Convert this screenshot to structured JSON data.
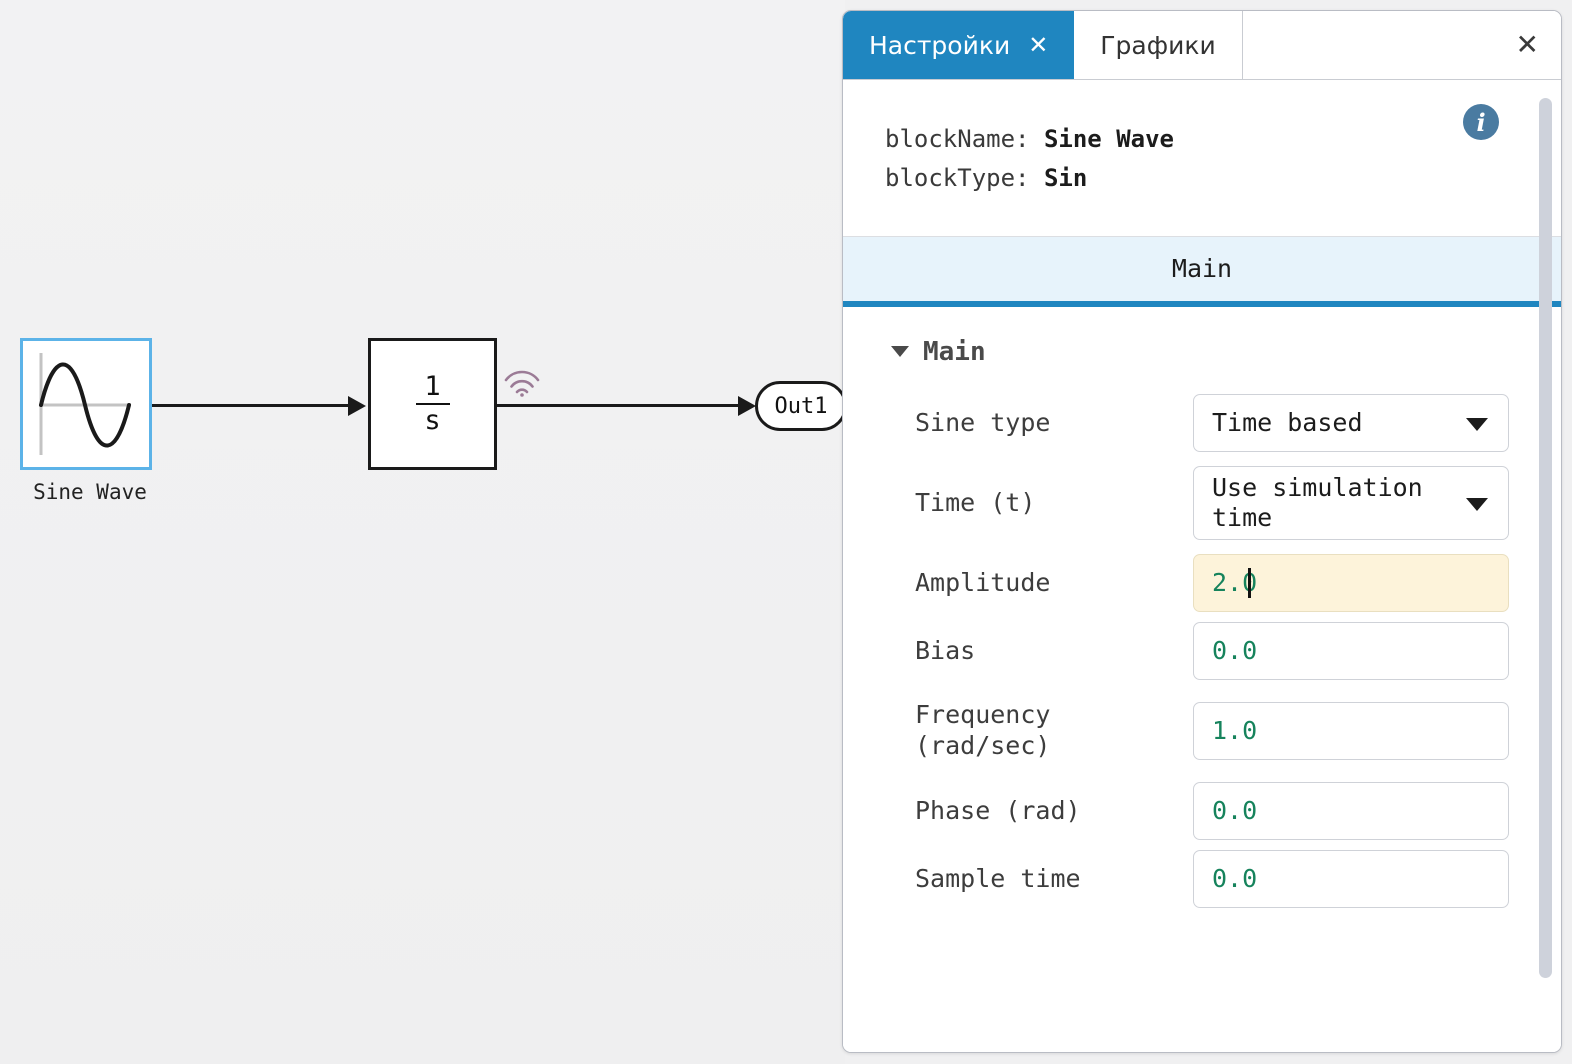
{
  "canvas": {
    "blocks": {
      "sine": {
        "label": "Sine Wave",
        "icon": "sine-wave-icon"
      },
      "integrator": {
        "numerator": "1",
        "denominator": "s",
        "icon": "integrator-icon"
      },
      "out_port": {
        "label": "Out1"
      }
    },
    "annotations": {
      "signal_icon": "signal-wifi-icon"
    }
  },
  "panel": {
    "tabs": [
      {
        "label": "Настройки",
        "close": "✕",
        "active": true
      },
      {
        "label": "Графики",
        "active": false
      }
    ],
    "close_label": "✕",
    "block_info": {
      "name_key": "blockName: ",
      "name_value": "Sine Wave",
      "type_key": "blockType: ",
      "type_value": "Sin",
      "info_icon": "info-icon"
    },
    "section_tabs": [
      {
        "label": "Main",
        "active": true
      }
    ],
    "group": {
      "caret": "▼",
      "title": "Main"
    },
    "fields": [
      {
        "label": "Sine type",
        "kind": "select",
        "value": "Time based",
        "active": false
      },
      {
        "label": "Time (t)",
        "kind": "select",
        "value": "Use simulation time",
        "active": false
      },
      {
        "label": "Amplitude",
        "kind": "text",
        "value": "2.0",
        "active": true
      },
      {
        "label": "Bias",
        "kind": "text",
        "value": "0.0",
        "active": false
      },
      {
        "label": "Frequency (rad/sec)",
        "kind": "text",
        "value": "1.0",
        "active": false
      },
      {
        "label": "Phase (rad)",
        "kind": "text",
        "value": "0.0",
        "active": false
      },
      {
        "label": "Sample time",
        "kind": "text",
        "value": "0.0",
        "active": false
      }
    ]
  },
  "colors": {
    "accent": "#1f86c0",
    "section_bg": "#e7f3fb",
    "active_field_bg": "#fdf3da",
    "value_text": "#16835c",
    "selection_border": "#5cb3e8",
    "signal_icon": "#9b7b96",
    "canvas_bg": "#f0f0f1"
  }
}
